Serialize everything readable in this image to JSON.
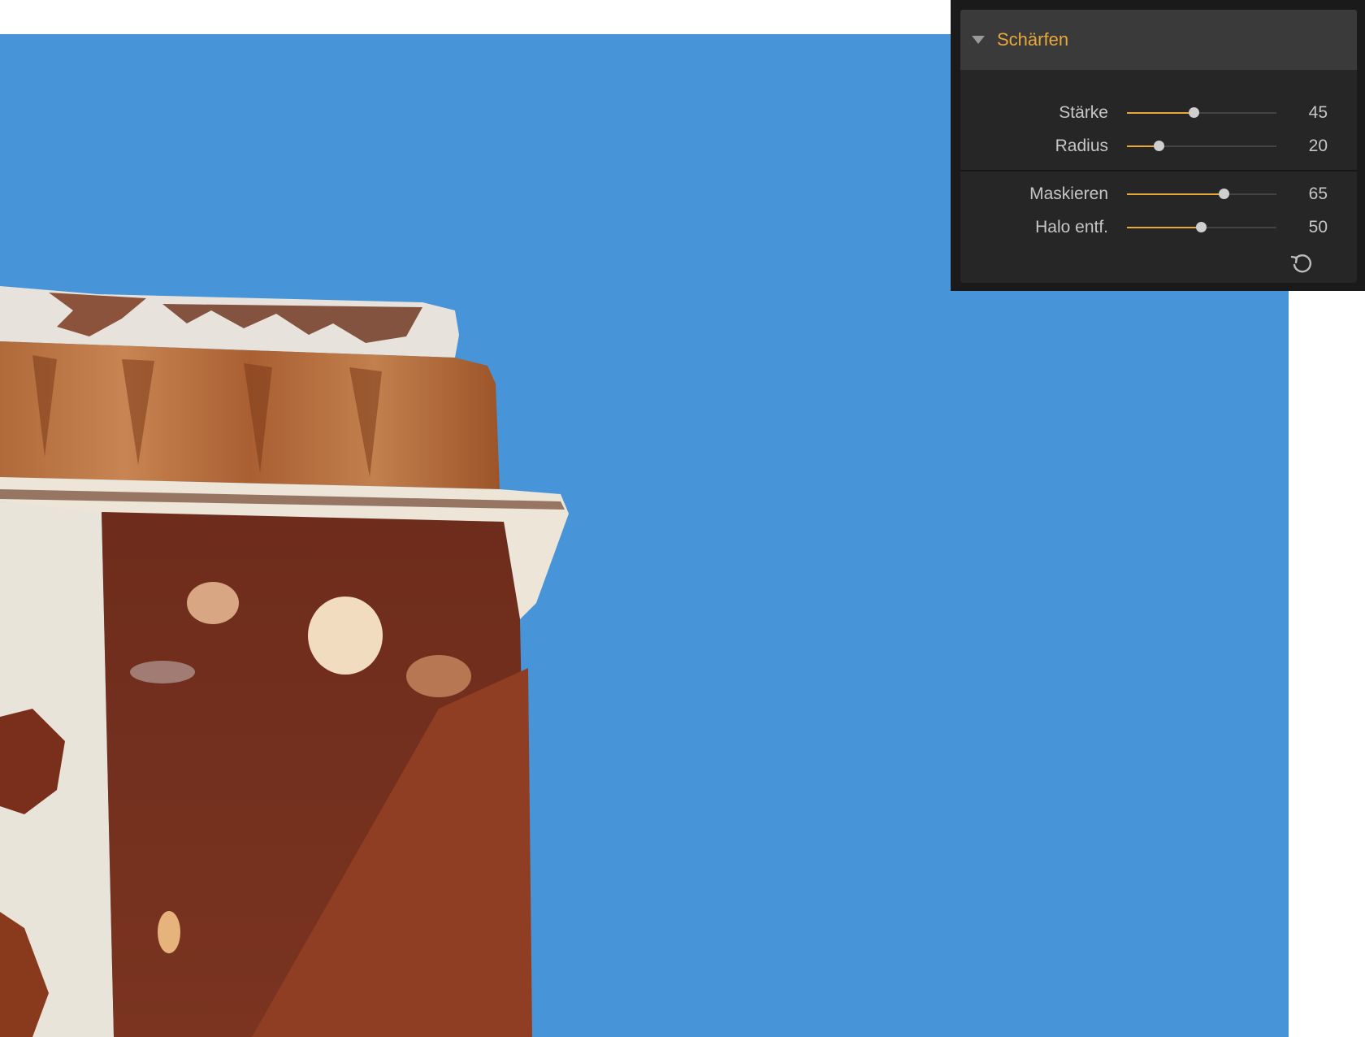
{
  "panel": {
    "title": "Schärfen",
    "sliders": [
      {
        "label": "Stärke",
        "value": "45",
        "level": 0.45
      },
      {
        "label": "Radius",
        "value": "20",
        "level": 0.22
      },
      {
        "label": "Maskieren",
        "value": "65",
        "level": 0.65
      },
      {
        "label": "Halo entf.",
        "value": "50",
        "level": 0.5
      }
    ],
    "icons": {
      "collapse": "triangle-down-icon",
      "reset": "reset-icon"
    }
  },
  "colors": {
    "accent": "#e8a93a",
    "sky": "#4894d9",
    "panel_bg": "#262626",
    "header_bg": "#3a3a3a"
  }
}
